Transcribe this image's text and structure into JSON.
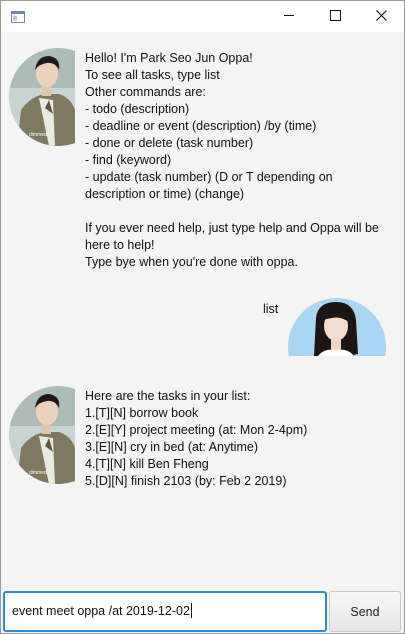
{
  "app": {
    "icon": "window-icon"
  },
  "window_controls": {
    "minimize": "minimize-icon",
    "maximize": "maximize-icon",
    "close": "close-icon"
  },
  "conversation": [
    {
      "sender": "bot",
      "avatar": "oppa-avatar",
      "text": "Hello! I'm Park Seo Jun Oppa!\nTo see all tasks, type list\nOther commands are:\n- todo (description)\n- deadline or event (description) /by (time)\n- done or delete (task number)\n- find (keyword)\n- update (task number) (D or T depending on\ndescription or time) (change)\n\nIf you ever need help, just type help and Oppa will be\nhere to help!\nType bye when you're done with oppa."
    },
    {
      "sender": "user",
      "avatar": "user-avatar",
      "text": "list"
    },
    {
      "sender": "bot",
      "avatar": "oppa-avatar",
      "text": "Here are the tasks in your list:\n1.[T][N] borrow book\n2.[E][Y] project meeting (at: Mon 2-4pm)\n3.[E][N] cry in bed (at: Anytime)\n4.[T][N] kill Ben Fheng\n5.[D][N] finish 2103 (by: Feb 2 2019)"
    }
  ],
  "input": {
    "value": "event meet oppa /at 2019-12-02"
  },
  "send_button": {
    "label": "Send"
  },
  "colors": {
    "focus_border": "#2a8fd8",
    "background": "#f4f4f4",
    "user_avatar_bg": "#a9d6f2"
  }
}
